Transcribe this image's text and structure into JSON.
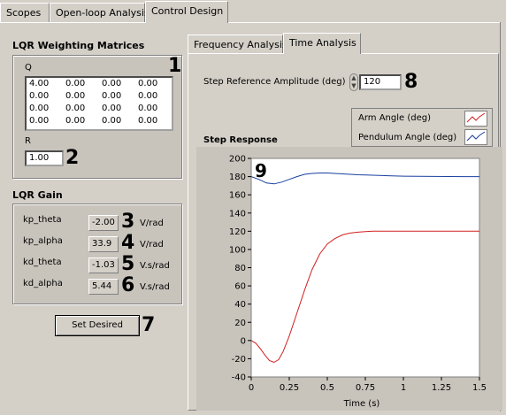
{
  "top_tabs": [
    "Scopes",
    "Open-loop Analysis",
    "Control Design"
  ],
  "lqr_weighting": {
    "title": "LQR Weighting Matrices",
    "q_label": "Q",
    "q_matrix": [
      [
        "4.00",
        "0.00",
        "0.00",
        "0.00"
      ],
      [
        "0.00",
        "0.00",
        "0.00",
        "0.00"
      ],
      [
        "0.00",
        "0.00",
        "0.00",
        "0.00"
      ],
      [
        "0.00",
        "0.00",
        "0.00",
        "0.00"
      ]
    ],
    "r_label": "R",
    "r_value": "1.00"
  },
  "lqr_gain": {
    "title": "LQR Gain",
    "rows": [
      {
        "name": "kp_theta",
        "value": "-2.00",
        "unit": "V/rad"
      },
      {
        "name": "kp_alpha",
        "value": "33.9",
        "unit": "V/rad"
      },
      {
        "name": "kd_theta",
        "value": "-1.03",
        "unit": "V.s/rad"
      },
      {
        "name": "kd_alpha",
        "value": "5.44",
        "unit": "V.s/rad"
      }
    ]
  },
  "set_desired_label": "Set Desired",
  "annotations": [
    "1",
    "2",
    "3",
    "4",
    "5",
    "6",
    "7",
    "8",
    "9"
  ],
  "inner_tabs": [
    "Frequency Analysis",
    "Time Analysis"
  ],
  "step_amp": {
    "label": "Step Reference Amplitude (deg)",
    "value": "120"
  },
  "legend": {
    "arm": "Arm Angle (deg)",
    "pendulum": "Pendulum Angle (deg)"
  },
  "colors": {
    "arm": "#d02020",
    "pendulum": "#1a3fa0"
  },
  "chart_data": {
    "type": "line",
    "title": "Step Response",
    "xlabel": "Time (s)",
    "ylabel": "",
    "xlim": [
      0,
      1.5
    ],
    "ylim": [
      -40,
      200
    ],
    "xticks": [
      "0",
      "0.25",
      "0.5",
      "0.75",
      "1",
      "1.25",
      "1.5"
    ],
    "yticks": [
      "200",
      "180",
      "160",
      "140",
      "120",
      "100",
      "80",
      "60",
      "40",
      "20",
      "0",
      "-20",
      "-40"
    ],
    "grid": false,
    "series": [
      {
        "name": "Arm Angle (deg)",
        "x": [
          0,
          0.03,
          0.06,
          0.09,
          0.12,
          0.15,
          0.18,
          0.21,
          0.25,
          0.3,
          0.35,
          0.4,
          0.45,
          0.5,
          0.55,
          0.6,
          0.65,
          0.7,
          0.75,
          0.8,
          0.85,
          0.9,
          1.0,
          1.1,
          1.2,
          1.3,
          1.4,
          1.5
        ],
        "y": [
          0,
          -3,
          -9,
          -16,
          -22,
          -24,
          -21,
          -12,
          5,
          30,
          55,
          78,
          95,
          106,
          112,
          116,
          118,
          119,
          119.5,
          120,
          120,
          120,
          120,
          120,
          120,
          120,
          120,
          120
        ]
      },
      {
        "name": "Pendulum Angle (deg)",
        "x": [
          0,
          0.05,
          0.1,
          0.15,
          0.2,
          0.25,
          0.3,
          0.35,
          0.4,
          0.45,
          0.5,
          0.55,
          0.6,
          0.7,
          0.8,
          0.9,
          1.0,
          1.1,
          1.2,
          1.3,
          1.4,
          1.5
        ],
        "y": [
          180,
          177,
          173,
          172,
          174,
          177,
          180,
          182.5,
          183.5,
          184,
          184,
          183.5,
          183,
          182,
          181.5,
          181,
          180.5,
          180.3,
          180.2,
          180.1,
          180,
          180
        ]
      }
    ]
  }
}
